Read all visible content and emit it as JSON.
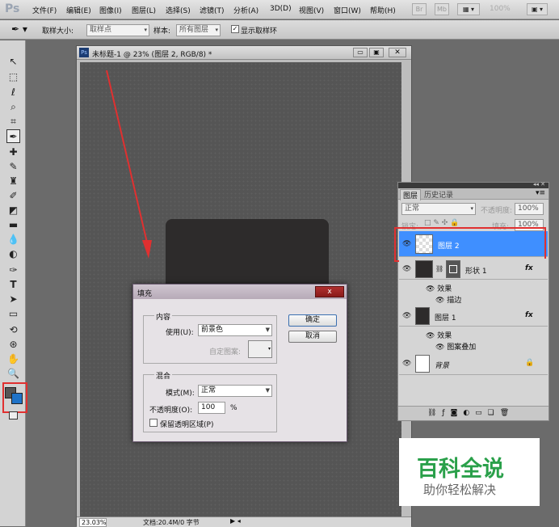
{
  "app": {
    "logo": "Ps"
  },
  "menu": [
    "文件(F)",
    "编辑(E)",
    "图像(I)",
    "图层(L)",
    "选择(S)",
    "滤镜(T)",
    "分析(A)",
    "3D(D)",
    "视图(V)",
    "窗口(W)",
    "帮助(H)"
  ],
  "menubar_right": {
    "br": "Br",
    "mb": "Mb",
    "zoom": "100%"
  },
  "options": {
    "sample_size_label": "取样大小:",
    "sample_size_value": "取样点",
    "sample_label": "样本:",
    "sample_value": "所有图层",
    "show_ring_label": "显示取样环",
    "show_ring_checked": true
  },
  "document": {
    "title": "未标题-1 @ 23% (图层 2, RGB/8) *",
    "status_zoom": "23.03%",
    "status_doc": "文档:20.4M/0 字节"
  },
  "dialog": {
    "title": "填充",
    "close": "x",
    "content_legend": "内容",
    "use_label": "使用(U):",
    "use_value": "前景色",
    "custom_pattern_label": "自定图案:",
    "blend_legend": "混合",
    "mode_label": "模式(M):",
    "mode_value": "正常",
    "opacity_label": "不透明度(O):",
    "opacity_value": "100",
    "opacity_unit": "%",
    "preserve_label": "保留透明区域(P)",
    "ok": "确定",
    "cancel": "取消"
  },
  "layers_panel": {
    "tab_layers": "图层",
    "tab_history": "历史记录",
    "blend_mode": "正常",
    "opacity_label": "不透明度:",
    "opacity_value": "100%",
    "lock_label": "锁定:",
    "fill_label": "填充:",
    "fill_value": "100%",
    "layers": [
      {
        "name": "图层 2",
        "selected": true
      },
      {
        "name": "形状 1",
        "fx": "fx",
        "effects": "效果",
        "effect_items": [
          "描边"
        ]
      },
      {
        "name": "图层 1",
        "fx": "fx",
        "effects": "效果",
        "effect_items": [
          "图案叠加"
        ]
      },
      {
        "name": "背景",
        "locked": true
      }
    ],
    "bottom_icons": [
      "link-icon",
      "fx-icon",
      "mask-icon",
      "adjustment-icon",
      "group-icon",
      "new-layer-icon",
      "trash-icon"
    ]
  },
  "watermark": {
    "title": "百科全说",
    "subtitle": "助你轻松解决"
  },
  "colors": {
    "selection": "#3f8fff",
    "annotation": "#e03030",
    "dark_shape": "#2d2b2b"
  }
}
